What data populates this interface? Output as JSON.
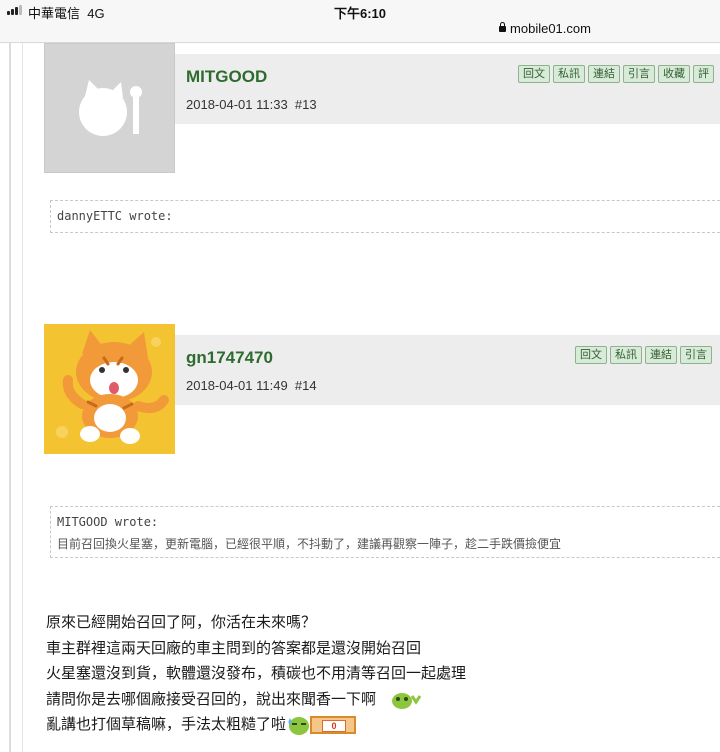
{
  "status_bar": {
    "carrier": "中華電信",
    "network": "4G",
    "time": "下午6:10",
    "url": "mobile01.com"
  },
  "posts": [
    {
      "username": "MITGOOD",
      "date": "2018-04-01 11:33",
      "floor": "#13",
      "buttons": [
        "回文",
        "私訊",
        "連結",
        "引言",
        "收藏",
        "評"
      ],
      "avatar": "default-cat-avatar"
    },
    {
      "username": "gn1747470",
      "date": "2018-04-01 11:49",
      "floor": "#14",
      "buttons": [
        "回文",
        "私訊",
        "連結",
        "引言"
      ],
      "avatar": "orange-cat-avatar"
    }
  ],
  "quotes": [
    {
      "author": "dannyETTC wrote:",
      "text": ""
    },
    {
      "author": "MITGOOD wrote:",
      "text": "目前召回換火星塞，更新電腦，已經很平順，不抖動了，建議再觀察一陣子，趁二手跌價撿便宜"
    }
  ],
  "body": {
    "lines": [
      "原來已經開始召回了阿，你活在未來嗎？",
      "車主群裡這兩天回廠的車主問到的答案都是還沒開始召回",
      "火星塞還沒到貨，軟體還沒發布，積碳也不用清等召回一起處理",
      "請問你是去哪個廠接受召回的，說出來聞香一下啊",
      "亂講也打個草稿嘛，手法太粗糙了啦"
    ],
    "emoticons": [
      "green-frog-emoticon",
      "sweat-emoticon",
      "money-emoticon"
    ],
    "money_label": "0"
  }
}
